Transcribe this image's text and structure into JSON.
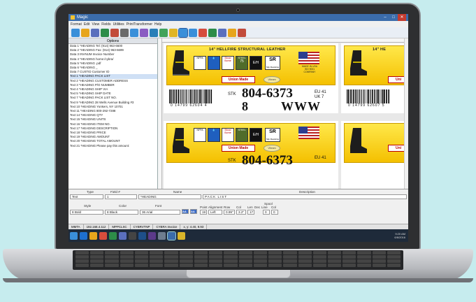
{
  "window": {
    "title": "Magic"
  },
  "menu": [
    "Format",
    "Edit",
    "View",
    "Fields",
    "Utilities",
    "PrintTransformer",
    "Help"
  ],
  "options_header": "Options",
  "fields": [
    "Data 1 *HEADING Tel: (914) 963-6600",
    "Data 2 *HEADING Fax: (914) 963-6699",
    "Data 3 INVNUM Invoice Number",
    "Data 4 *HEADING home:/cybra/",
    "Data 5 *HEADING .pdf",
    "Data 6 *HEADING _",
    "Data 7 CUSTID Customer ID",
    "Text 1 *HEADING PACK LIST",
    "Text 2 *HEADING CUSTOMER ADDRESS",
    "Text 3 *HEADING P/O NUMBER",
    "Text 4 *HEADING SHIP VIA",
    "Text 5 *HEADING SHIP DATE",
    "Text 7 *HEADING PACK LIST NO.",
    "Text 9 *HEADING 28 Wells Avenue Building #3",
    "Text 10 *HEADING Yonkers, NY 10701",
    "Text 11 *HEADING 800-292-7288",
    "Text 14 *HEADING QTY",
    "Text 15 *HEADING UNITS",
    "Text 16 *HEADING ITEM NO.",
    "Text 17 *HEADING DESCRIPTION",
    "Text 18 *HEADING PRICE",
    "Text 19 *HEADING AMOUNT",
    "Text 20 *HEADING TOTAL AMOUNT",
    "Text 21 *HEADING Please pay this amount:"
  ],
  "selected_field_index": 7,
  "label": {
    "title": "14\" HELLFIRE STRUCTURAL LEATHER",
    "title_short": "14\" HE",
    "union": "Union Made",
    "union_short": "Uni",
    "oval": "Vibram",
    "made_in_usa": "MADE IN USA",
    "iso": "ISO 9001 COMPANY",
    "nfpa": "NFPA",
    "blood": "Blood Borne",
    "steel": "STEEL",
    "steel_num": "75",
    "eh": "E/H",
    "sr": "SR",
    "slip": "Slip Resisting",
    "barcode_text": "0 14799 62604 4",
    "barcode_text_2": "0 14799 62607 5",
    "stk_prefix": "STK",
    "stk": "804-6373",
    "eu": "EU 41",
    "uk": "UK 7",
    "size": "8",
    "width": "WWW"
  },
  "props": {
    "type_label": "Type",
    "field_label": "Field #",
    "name_label": "Name",
    "desc_label": "Description",
    "type_value": "Text",
    "field_value": "1",
    "name_value": "*HEADING",
    "desc_value": "PACK LIST",
    "style_label": "Style",
    "color_label": "Color",
    "font_label": "Font",
    "style_value": "8 Bold",
    "color_value": "8 Black",
    "font_value": "36 Arial",
    "aa1": "AA",
    "aa2": "AA",
    "point_label": "Point",
    "align_label": "Alignment",
    "row_label": "Row",
    "col_label": "Col",
    "len_label": "Len",
    "dec_label": "Dec",
    "spool_label": "Spool",
    "line_label": "Line",
    "col2_label": "Col",
    "point_value": "19",
    "align_value": "Left",
    "row_value": "0.99\"",
    "col_value": "3.2\"",
    "len_value": "17",
    "line_value": "0",
    "col2_value": "0"
  },
  "status": [
    "MMTA",
    "192.168.4.112",
    "MPPCLSC",
    "CYBRVTNP",
    "CYBRA Invoice",
    "x, y: 4.40, 9.93"
  ],
  "tray": {
    "time": "9:20 AM",
    "date": "6/6/2016"
  }
}
